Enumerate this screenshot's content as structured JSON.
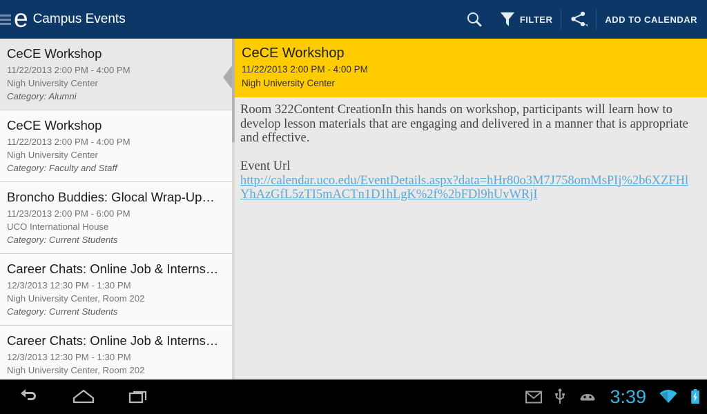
{
  "appbar": {
    "menu_icon": "hamburger-icon",
    "logo_letter": "e",
    "title": "Campus Events",
    "actions": {
      "search_icon": "search-icon",
      "filter_icon": "filter-icon",
      "filter_label": "FILTER",
      "share_icon": "share-icon",
      "add_to_calendar_label": "ADD TO CALENDAR"
    },
    "bg_color": "#0d3767",
    "text_color": "#ffffff"
  },
  "list": {
    "items": [
      {
        "title": "CeCE Workshop",
        "datetime": "11/22/2013 2:00 PM - 4:00 PM",
        "location": "Nigh University Center",
        "category": "Category: Alumni",
        "selected": true
      },
      {
        "title": "CeCE Workshop",
        "datetime": "11/22/2013 2:00 PM - 4:00 PM",
        "location": "Nigh University Center",
        "category": "Category: Faculty and Staff",
        "selected": false
      },
      {
        "title": "Broncho Buddies: Glocal Wrap-Up…",
        "datetime": "11/23/2013 2:00 PM - 6:00 PM",
        "location": "UCO International House",
        "category": "Category: Current Students",
        "selected": false
      },
      {
        "title": "Career Chats: Online Job & Interns…",
        "datetime": "12/3/2013 12:30 PM - 1:30 PM",
        "location": "Nigh University Center, Room 202",
        "category": "Category: Current Students",
        "selected": false
      },
      {
        "title": "Career Chats: Online Job & Interns…",
        "datetime": "12/3/2013 12:30 PM - 1:30 PM",
        "location": "Nigh University Center, Room 202",
        "category": "",
        "selected": false
      }
    ],
    "handle_icon": "collapse-left-triangle-icon"
  },
  "detail": {
    "header_bg": "#ffcc00",
    "title": "CeCE Workshop",
    "datetime": "11/22/2013 2:00 PM -  4:00 PM",
    "location": "Nigh University Center",
    "description": "Room 322Content CreationIn this hands on workshop, participants will learn how to develop lesson materials that are engaging and delivered in a manner that is appropriate and effective.",
    "url_label": "Event Url",
    "url": "http://calendar.uco.edu/EventDetails.aspx?data=hHr80o3M7J758omMsPIj%2b6XZFHlYhAzGfL5zTI5mACTn1D1hLgK%2f%2bFDl9hUvWRjI",
    "link_color": "#5aa9d6"
  },
  "systembar": {
    "back_icon": "back-arrow-icon",
    "home_icon": "home-icon",
    "recents_icon": "recent-apps-icon",
    "gmail_icon": "gmail-icon",
    "usb_icon": "usb-icon",
    "android_icon": "android-debug-icon",
    "clock": "3:39",
    "wifi_icon": "wifi-icon",
    "battery_icon": "battery-charging-icon",
    "clock_color": "#33b5e5"
  }
}
